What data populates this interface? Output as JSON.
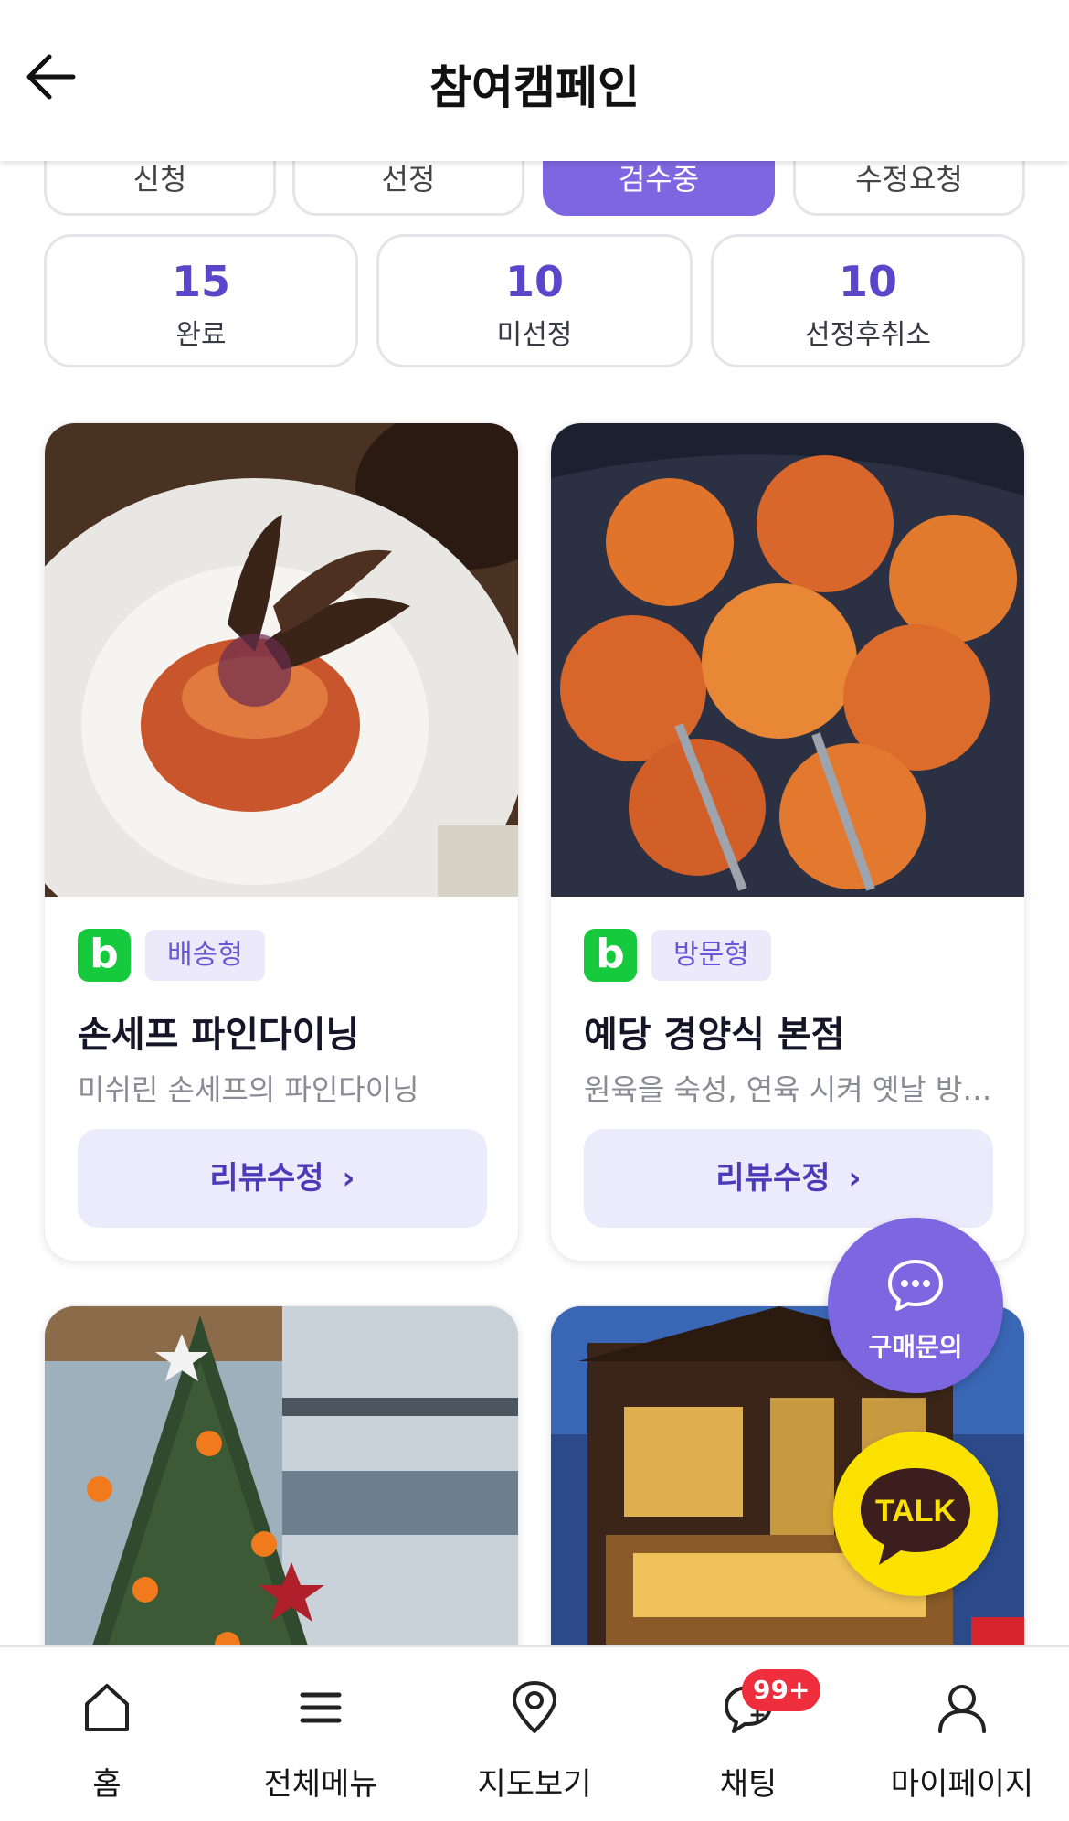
{
  "header": {
    "title": "참여캠페인"
  },
  "status_tabs": [
    {
      "label": "신청",
      "active": false
    },
    {
      "label": "선정",
      "active": false
    },
    {
      "label": "검수중",
      "active": true
    },
    {
      "label": "수정요청",
      "active": false
    }
  ],
  "counts": [
    {
      "value": "15",
      "label": "완료"
    },
    {
      "value": "10",
      "label": "미선정"
    },
    {
      "value": "10",
      "label": "선정후취소"
    }
  ],
  "campaigns": [
    {
      "blog_icon": "b",
      "type": "배송형",
      "title": "손세프 파인다이닝",
      "desc": "미쉬린 손세프의 파인다이닝",
      "button": "리뷰수정"
    },
    {
      "blog_icon": "b",
      "type": "방문형",
      "title": "예당 경양식 본점",
      "desc": "원육을 숙성, 연육 시켜 옛날 방식으로 만든 경양식",
      "button": "리뷰수정"
    }
  ],
  "floating": {
    "inquiry_label": "구매문의",
    "talk_label": "TALK"
  },
  "bottom_nav": [
    {
      "label": "홈",
      "icon": "home-icon"
    },
    {
      "label": "전체메뉴",
      "icon": "menu-icon"
    },
    {
      "label": "지도보기",
      "icon": "map-pin-icon"
    },
    {
      "label": "채팅",
      "icon": "chat-icon",
      "badge": "99+"
    },
    {
      "label": "마이페이지",
      "icon": "user-icon"
    }
  ],
  "colors": {
    "accent": "#7c67e0",
    "accent_dark": "#5b46c9",
    "blog_green": "#17c93d",
    "kakao_yellow": "#fae100",
    "badge_red": "#ee2e3c"
  }
}
